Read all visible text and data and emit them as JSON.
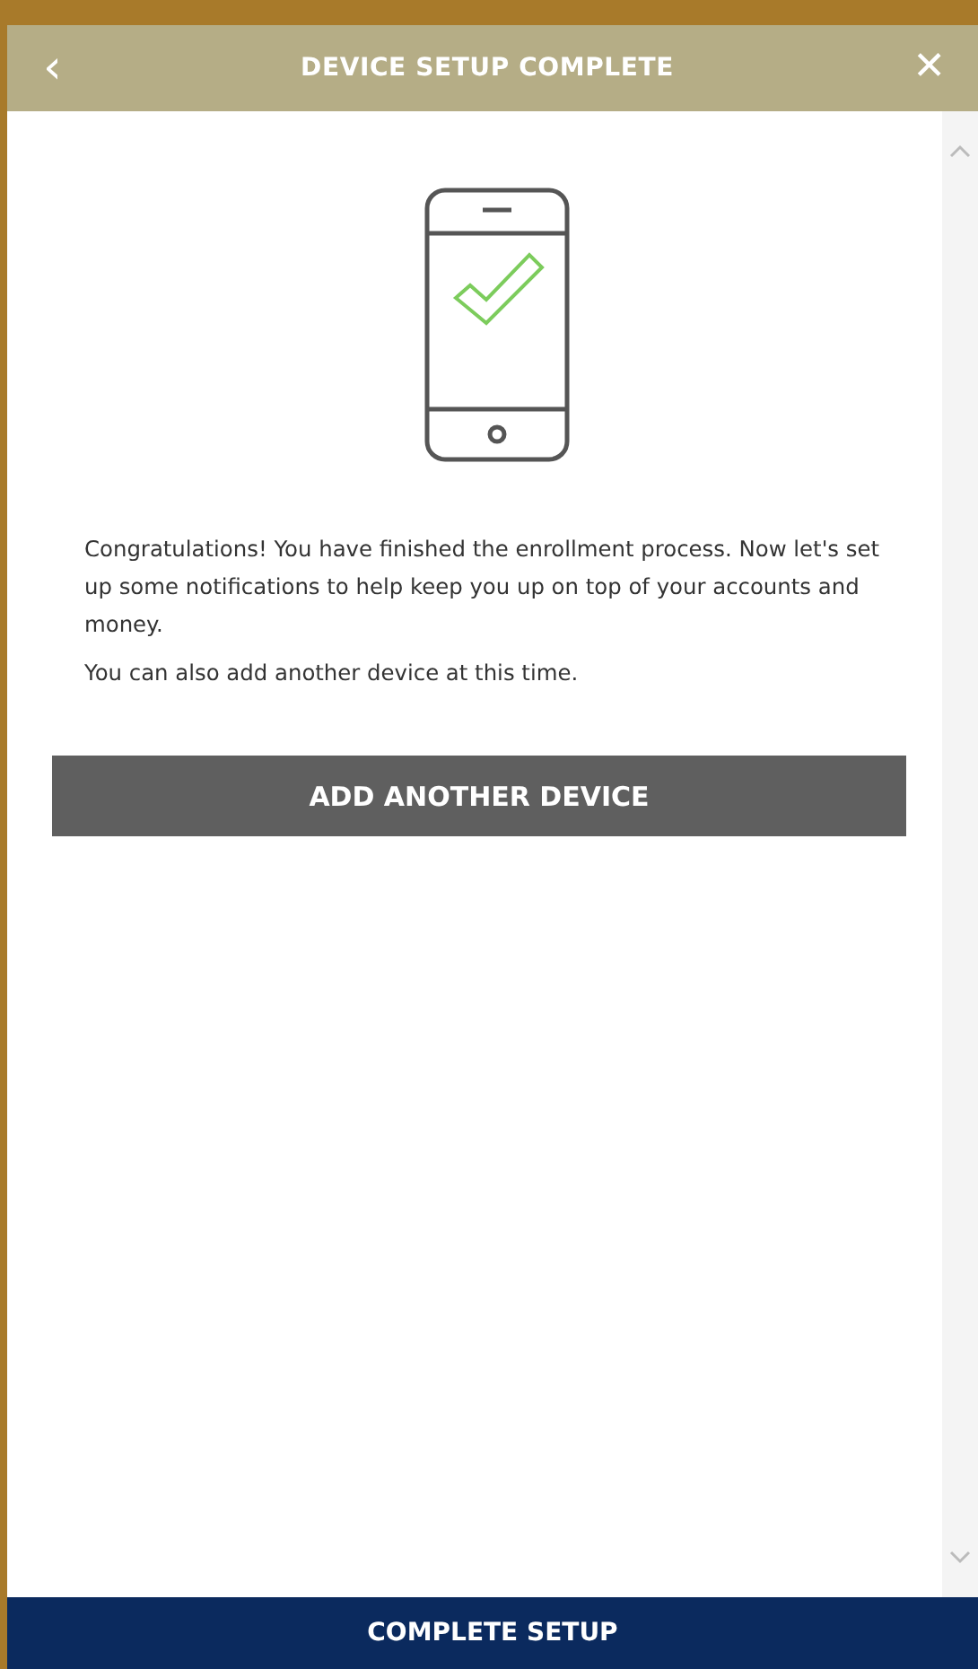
{
  "header": {
    "back": "‹",
    "title": "DEVICE SETUP COMPLETE",
    "close": "✕"
  },
  "message": [
    "Congratulations! You have finished the enrollment process. Now let's set up some notifications to help keep you up on top of your accounts and money.",
    "You can also add another device at this time."
  ],
  "add_button": "ADD ANOTHER DEVICE",
  "complete_button": "COMPLETE SETUP"
}
